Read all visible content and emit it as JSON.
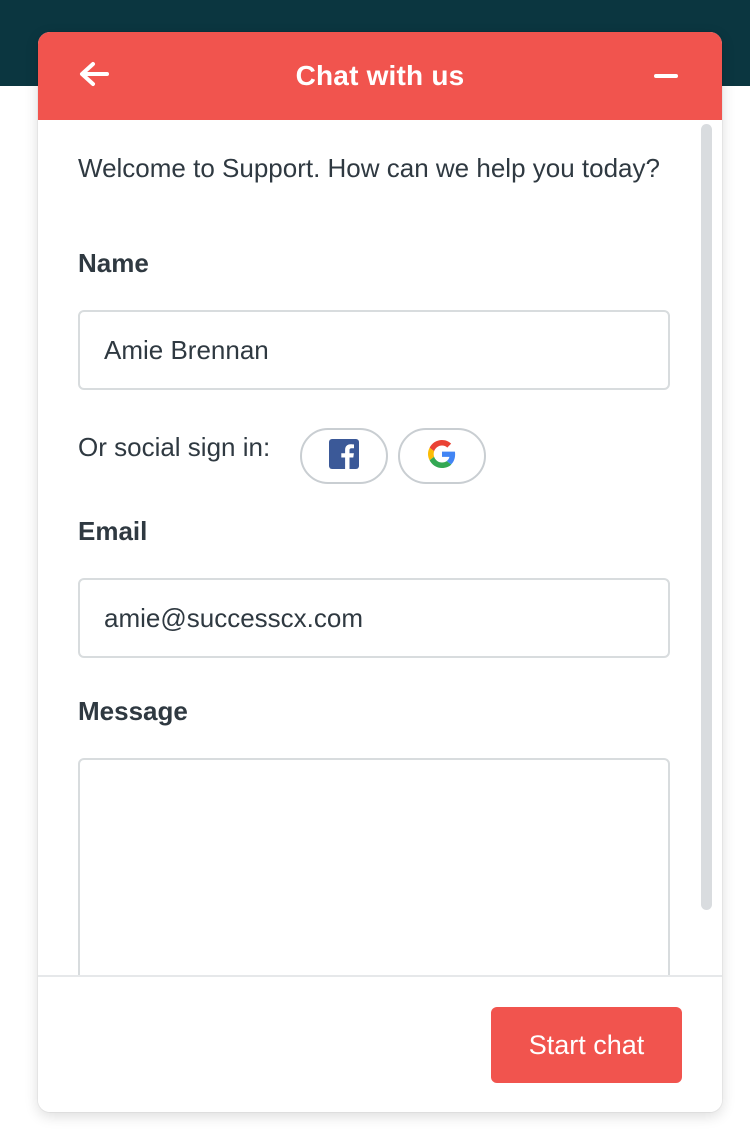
{
  "header": {
    "title": "Chat with us",
    "back_icon": "arrow-left-icon",
    "minimize_icon": "minus-icon"
  },
  "form": {
    "welcome_text": "Welcome to Support. How can we help you today?",
    "name": {
      "label": "Name",
      "value": "Amie Brennan"
    },
    "social": {
      "label": "Or social sign in:",
      "providers": [
        "facebook-icon",
        "google-icon"
      ]
    },
    "email": {
      "label": "Email",
      "value": "amie@successcx.com"
    },
    "message": {
      "label": "Message",
      "value": ""
    }
  },
  "footer": {
    "start_label": "Start chat"
  },
  "colors": {
    "brand": "#f1544e",
    "background_band": "#0b3640",
    "text": "#2f3941",
    "facebook": "#3b5998"
  }
}
